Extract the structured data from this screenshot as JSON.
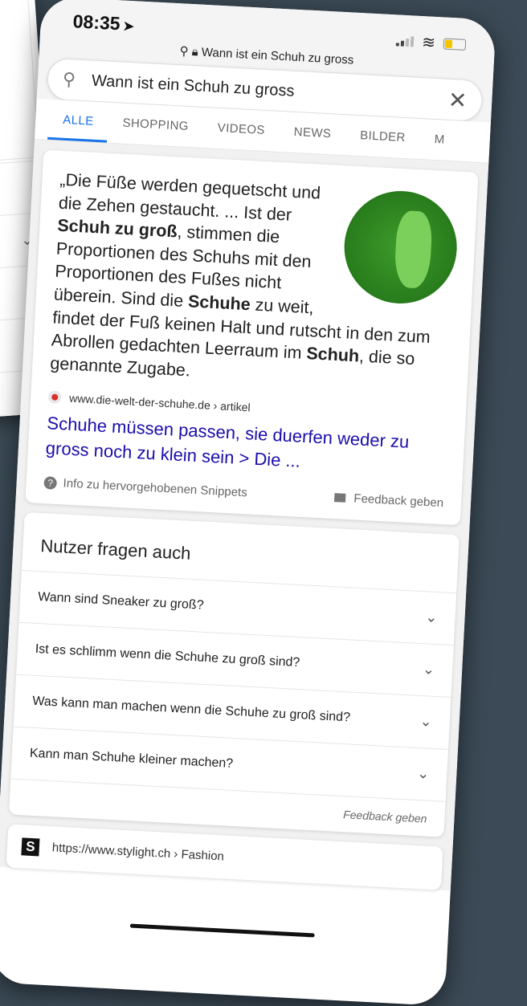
{
  "status": {
    "time": "08:35",
    "url": "Wann ist ein Schuh zu gross"
  },
  "search": {
    "query": "Wann ist ein Schuh zu gross"
  },
  "tabs": [
    {
      "label": "ALLE"
    },
    {
      "label": "SHOPPING"
    },
    {
      "label": "VIDEOS"
    },
    {
      "label": "NEWS"
    },
    {
      "label": "BILDER"
    },
    {
      "label": "M"
    }
  ],
  "snippet": {
    "text_1": "„Die Füße werden gequetscht und die Zehen gestaucht. ... Ist der ",
    "bold_1": "Schuh zu groß",
    "text_2": ", stimmen die Proportionen des Schuhs mit den Proportionen des Fußes nicht überein. Sind die ",
    "bold_2": "Schuhe",
    "text_3": " zu weit, findet der Fuß keinen Halt und rutscht in den zum Abrollen gedachten Leerraum im ",
    "bold_3": "Schuh",
    "text_4": ", die so genannte Zugabe.",
    "source": "www.die-welt-der-schuhe.de › artikel",
    "link_title": "Schuhe müssen passen, sie duerfen weder zu gross noch zu klein sein > Die ...",
    "info": "Info zu hervorgehobenen Snippets",
    "feedback": "Feedback geben"
  },
  "paa": {
    "title": "Nutzer fragen auch",
    "questions": [
      "Wann sind Sneaker zu groß?",
      "Ist es schlimm wenn die Schuhe zu groß sind?",
      "Was kann man machen wenn die Schuhe zu groß sind?",
      "Kann man Schuhe kleiner machen?"
    ],
    "feedback": "Feedback geben"
  },
  "result2": {
    "logo": "S",
    "url": "https://www.stylight.ch › Fashion"
  }
}
